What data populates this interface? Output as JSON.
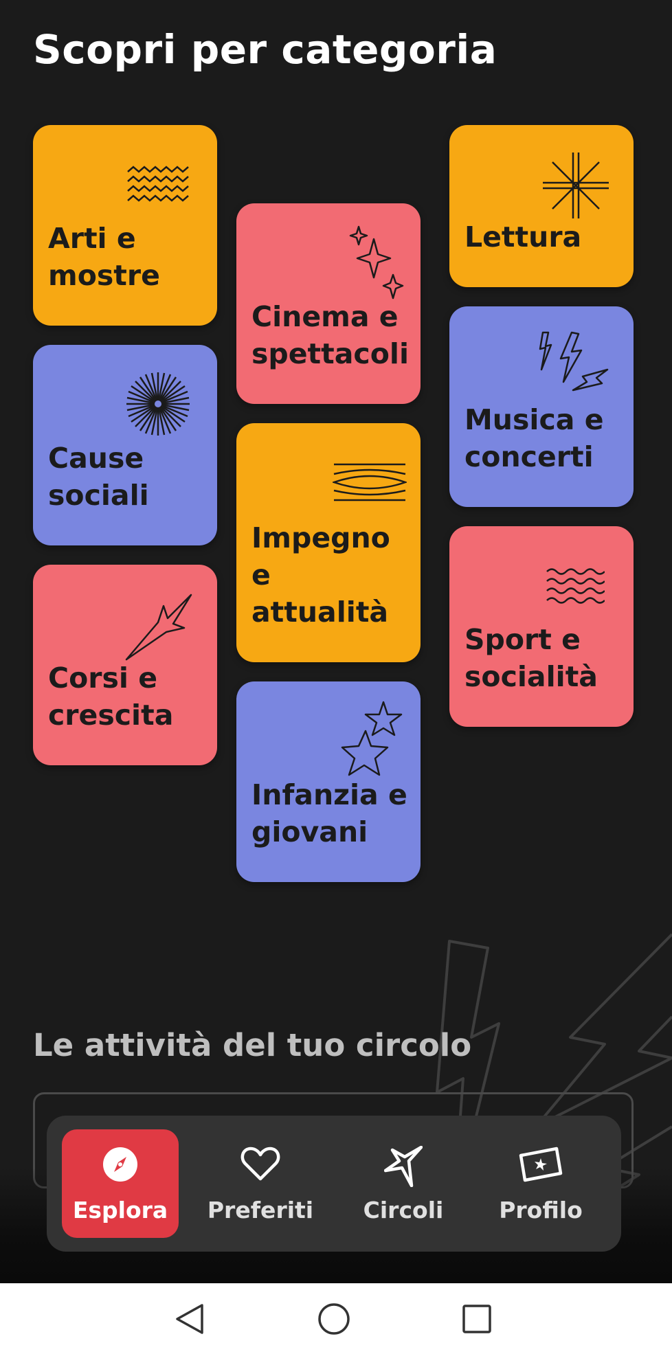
{
  "header": {
    "title": "Scopri per categoria"
  },
  "categories": [
    {
      "label": "Arti e\nmostre",
      "icon": "zigzag-icon",
      "color": "#f7a813"
    },
    {
      "label": "Cinema e\nspettacoli",
      "icon": "sparkles-icon",
      "color": "#f26b73"
    },
    {
      "label": "Lettura",
      "icon": "asterisk-icon",
      "color": "#f7a813"
    },
    {
      "label": "Cause\nsociali",
      "icon": "starburst-icon",
      "color": "#7a86e0"
    },
    {
      "label": "Musica e\nconcerti",
      "icon": "lightning-icon",
      "color": "#7a86e0"
    },
    {
      "label": "Impegno\ne\nattualità",
      "icon": "lens-lines-icon",
      "color": "#f7a813"
    },
    {
      "label": "Corsi e\ncrescita",
      "icon": "compass-star-icon",
      "color": "#f26b73"
    },
    {
      "label": "Sport e\nsocialità",
      "icon": "waves-icon",
      "color": "#f26b73"
    },
    {
      "label": "Infanzia e\ngiovani",
      "icon": "stars-icon",
      "color": "#7a86e0"
    }
  ],
  "circle_section": {
    "title": "Le attività del tuo circolo"
  },
  "nav": {
    "items": [
      {
        "label": "Esplora",
        "icon": "compass-icon",
        "active": true
      },
      {
        "label": "Preferiti",
        "icon": "heart-icon",
        "active": false
      },
      {
        "label": "Circoli",
        "icon": "star-arrow-icon",
        "active": false
      },
      {
        "label": "Profilo",
        "icon": "ticket-icon",
        "active": false
      }
    ],
    "active_color": "#e03a44"
  },
  "system_nav": {
    "buttons": [
      "back-icon",
      "home-icon",
      "recents-icon"
    ]
  }
}
